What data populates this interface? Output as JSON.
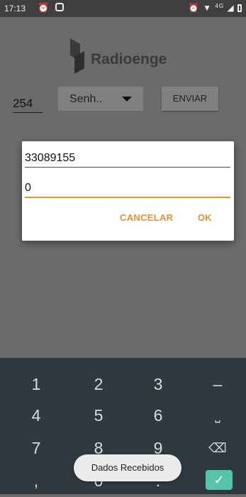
{
  "status_bar": {
    "time": "17:13",
    "alarm_icon": "alarm-icon",
    "right": "⏰ ▾ ",
    "network": "4G"
  },
  "app": {
    "logo_text": "Radioenge",
    "number_value": "254",
    "spinner_value": "Senh..",
    "send_label": "ENVIAR"
  },
  "dialog": {
    "field1_value": "33089155",
    "field2_value": "0",
    "cancel_label": "CANCELAR",
    "ok_label": "OK",
    "accent_color": "#e8923a"
  },
  "keyboard": {
    "row1": [
      "1",
      "2",
      "3",
      "–"
    ],
    "row2": [
      "4",
      "5",
      "6",
      "⎵"
    ],
    "row3": [
      "7",
      "8",
      "9",
      "⌫"
    ],
    "row4": [
      ",",
      "0",
      ".",
      "✓"
    ]
  },
  "toast": {
    "text": "Dados Recebidos"
  }
}
